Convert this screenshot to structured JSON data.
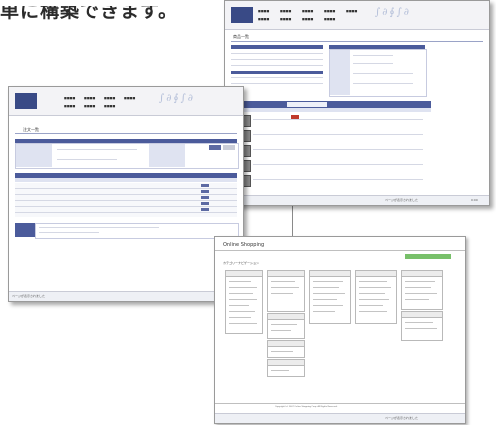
{
  "headline": "単に構築できます。",
  "window_right": {
    "page_title": "商品一覧",
    "status_text": "ページが表示されました",
    "footer_page_label": "0:00"
  },
  "window_left": {
    "page_title": "注文一覧",
    "status_text": "ページが表示されました"
  },
  "window_bottom": {
    "shop_name": "Online Shopping",
    "section_title": "カテゴリーナビゲーション",
    "copyright": "Copyright (c) 2007 Online Shopping Corp. All Rights Reserved.",
    "status_text": "ページが表示されました"
  },
  "colors": {
    "accent": "#4b5b9b",
    "logo": "#394a86",
    "green_button": "#78c06a"
  }
}
